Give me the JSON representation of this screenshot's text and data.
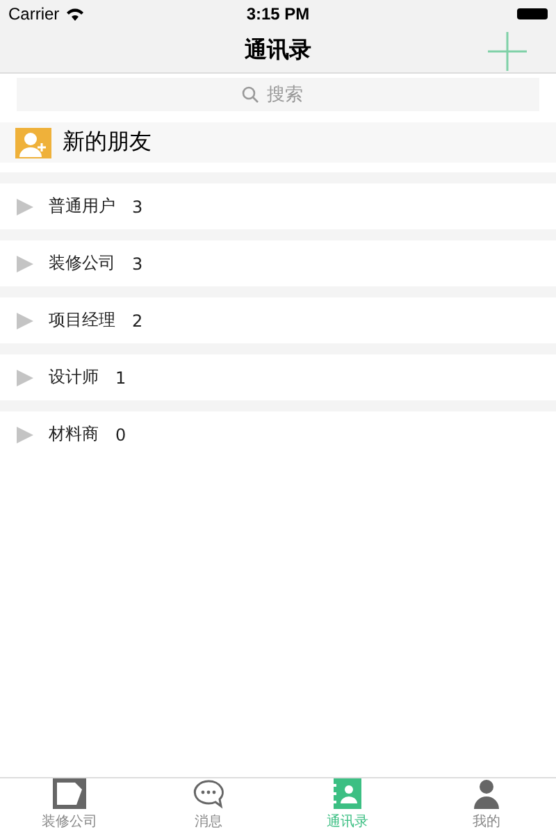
{
  "status_bar": {
    "carrier": "Carrier",
    "time": "3:15 PM"
  },
  "nav_bar": {
    "title": "通讯录"
  },
  "search": {
    "placeholder": "搜索"
  },
  "new_friends": {
    "label": "新的朋友"
  },
  "groups": [
    {
      "name": "普通用户",
      "count": "3",
      "expanded": false
    },
    {
      "name": "装修公司",
      "count": "3",
      "expanded": false
    },
    {
      "name": "项目经理",
      "count": "2",
      "expanded": false
    },
    {
      "name": "设计师",
      "count": "1",
      "expanded": false
    },
    {
      "name": "材料商",
      "count": "0",
      "expanded": false
    }
  ],
  "tab_bar": [
    {
      "label": "装修公司",
      "kind": "company",
      "selected": false
    },
    {
      "label": "消息",
      "kind": "message",
      "selected": false
    },
    {
      "label": "通讯录",
      "kind": "contacts",
      "selected": true
    },
    {
      "label": "我的",
      "kind": "profile",
      "selected": false
    }
  ]
}
